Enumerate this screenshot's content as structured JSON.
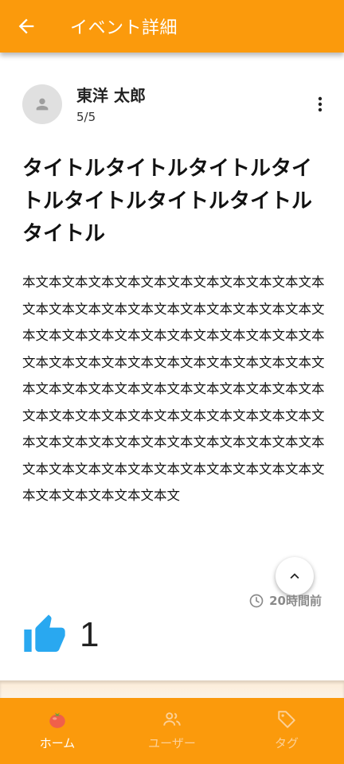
{
  "appbar": {
    "title": "イベント詳細",
    "back_icon": "arrow-back-icon"
  },
  "author": {
    "name": "東洋 太郎",
    "sub": "5/5",
    "avatar_icon": "person-icon",
    "more_icon": "more-vert-icon"
  },
  "event": {
    "title": "タイトルタイトルタイトルタイトルタイトルタイトルタイトルタイトル",
    "body": "本文本文本文本文本文本文本文本文本文本文本文本文本文本文本文本文本文本文本文本文本文本文本文本文本文本文本文本文本文本文本文本文本文本文本文本文本文本文本文本文本文本文本文本文本文本文本文本文本文本文本文本文本文本文本文本文本文本文本文本文本文本文本文本文本文本文本文本文本文本文本文本文本文本文本文本文本文本文本文本文本文本文本文本文本文本文本文本文本文本文本文本文本文本文本文本文本文本文"
  },
  "meta": {
    "time": "20時間前",
    "clock_icon": "clock-icon",
    "scroll_top_icon": "chevron-up-icon"
  },
  "likes": {
    "count": "1",
    "icon": "thumb-up-icon"
  },
  "nav": {
    "items": [
      {
        "label": "ホーム",
        "icon": "tomato-icon",
        "active": true
      },
      {
        "label": "ユーザー",
        "icon": "people-icon",
        "active": false
      },
      {
        "label": "タグ",
        "icon": "tag-icon",
        "active": false
      }
    ]
  },
  "colors": {
    "primary": "#fb9a0c",
    "like": "#29a8f0",
    "nav_inactive": "#fcd096"
  }
}
